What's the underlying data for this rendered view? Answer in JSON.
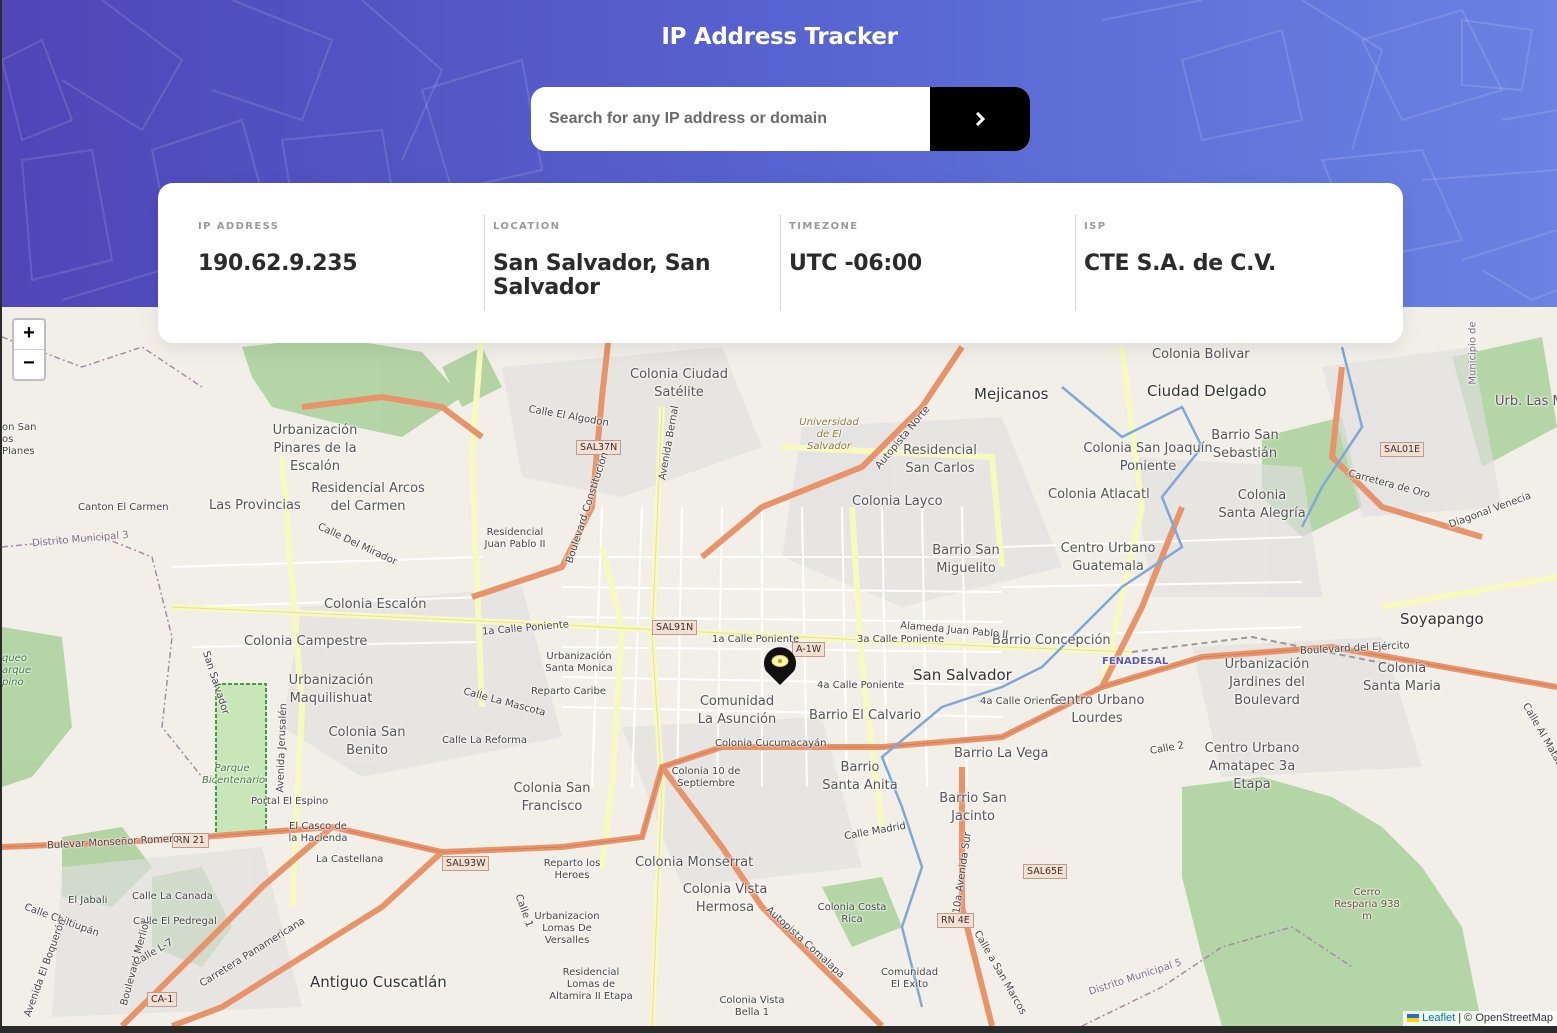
{
  "app": {
    "title": "IP Address Tracker"
  },
  "search": {
    "placeholder": "Search for any IP address or domain",
    "value": "",
    "button_icon": "chevron-right-icon"
  },
  "info": [
    {
      "label": "IP ADDRESS",
      "value": "190.62.9.235"
    },
    {
      "label": "LOCATION",
      "value": "San Salvador, San Salvador"
    },
    {
      "label": "TIMEZONE",
      "value": "UTC -06:00"
    },
    {
      "label": "ISP",
      "value": "CTE S.A. de C.V."
    }
  ],
  "map": {
    "zoom_in": "+",
    "zoom_out": "−",
    "marker_icon": "location-pin-icon",
    "attribution": {
      "leaflet": "Leaflet",
      "separator": "|",
      "osm": "© OpenStreetMap"
    },
    "places": [
      "Colonia Bolivar",
      "Colonia Ciudad Satélite",
      "Mejicanos",
      "Ciudad Delgado",
      "Urb. Las Marg",
      "Universidad de El Salvador",
      "Residencial San Carlos",
      "Colonia San Joaquín Poniente",
      "Barrio San Sebastián",
      "Urbanización Pinares de la Escalón",
      "Residencial Arcos del Carmen",
      "Las Provincias",
      "Colonia Layco",
      "Colonia Atlacatl",
      "Colonia Santa Alegría",
      "Canton El Carmen",
      "Distrito Municipal 3",
      "Residencial Juan Pablo II",
      "Barrio San Miguelito",
      "Centro Urbano Guatemala",
      "Colonia Escalón",
      "Colonia Campestre",
      "Soyapango",
      "Barrio Concepción",
      "FENADESAL",
      "Urbanización Santa Monica",
      "Reparto Caribe",
      "San Salvador",
      "Urbanización Maquilishuat",
      "Comunidad La Asunción",
      "Barrio El Calvario",
      "Centro Urbano Lourdes",
      "Urbanización Jardines del Boulevard",
      "Colonia Santa Maria",
      "Colonia San Benito",
      "Colonia Cucumacayán",
      "Barrio La Vega",
      "Centro Urbano Amatapec 3a Etapa",
      "Parque Bicentenario",
      "Colonia 10 de Septiembre",
      "Barrio Santa Anita",
      "Colonia San Francisco",
      "Portal El Espino",
      "Barrio San Jacinto",
      "El Casco de la Hacienda",
      "La Castellana",
      "Reparto los Heroes",
      "Colonia Monserrat",
      "Colonia Vista Hermosa",
      "Cerro Resparia 938 m",
      "El Jabali",
      "Calle La Canada",
      "Calle El Pedregal",
      "Urbanizacion Lomas De Versalles",
      "Colonia Costa Rica",
      "Antiguo Cuscatlán",
      "Residencial Lomas de Altamira II Etapa",
      "Comunidad El Exito",
      "Colonia Vista Bella 1",
      "Distrito Municipal 5",
      "on San os Planes",
      "queo arque pino",
      "Municipio de"
    ],
    "roads": [
      "Calle El Algodon",
      "SAL37N",
      "Avenida Bernal",
      "Boulevard Constitución",
      "Autopista Norte",
      "Calle Del Mirador",
      "1a Calle Poniente",
      "SAL91N",
      "1a Calle Poniente",
      "A-1W",
      "3a Calle Poniente",
      "Alameda Juan Pablo II",
      "Boulevard del Ejército",
      "4a Calle Poniente",
      "4a Calle Oriente",
      "Calle La Mascota",
      "Calle La Reforma",
      "Calle 2",
      "Calle Madrid",
      "RN 21",
      "Bulevar Monseñor Romero",
      "SAL93W",
      "SAL65E",
      "RN 4E",
      "Carretera Panamericana",
      "CA-1",
      "Autopista Comalapa",
      "Calle Chiltiupán",
      "Boulevard Merliot",
      "Avenida El Boquerón",
      "Calle L-7",
      "Calle 1",
      "SAL01E",
      "Carretera de Oro",
      "Diagonal Venecia",
      "Calle Al Matazano",
      "Avenida Jerusalén",
      "San Salvador",
      "10a Avenida Sur",
      "Calle a San Marcos"
    ]
  }
}
